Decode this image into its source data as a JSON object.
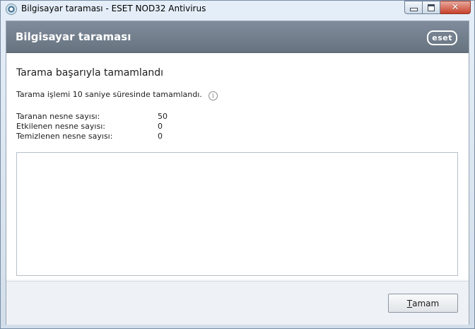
{
  "window": {
    "title": "Bilgisayar taraması - ESET NOD32 Antivirus",
    "icon": "eset-app-icon",
    "controls": {
      "minimize": "minimize-icon",
      "maximize": "maximize-icon",
      "close": "close-icon"
    }
  },
  "header": {
    "title": "Bilgisayar taraması",
    "logo_text": "eset"
  },
  "result": {
    "title": "Tarama başarıyla tamamlandı",
    "message": "Tarama işlemi 10 saniye süresinde tamamlandı.",
    "info_icon": "info-icon"
  },
  "stats": [
    {
      "label": "Taranan nesne sayısı:",
      "value": "50"
    },
    {
      "label": "Etkilenen nesne sayısı:",
      "value": "0"
    },
    {
      "label": "Temizlenen nesne sayısı:",
      "value": "0"
    }
  ],
  "footer": {
    "ok_mnemonic": "T",
    "ok_rest": "amam"
  },
  "colors": {
    "header_bg": "#737f8d",
    "content_bg": "#ffffff",
    "footer_bg": "#eef1f5"
  }
}
